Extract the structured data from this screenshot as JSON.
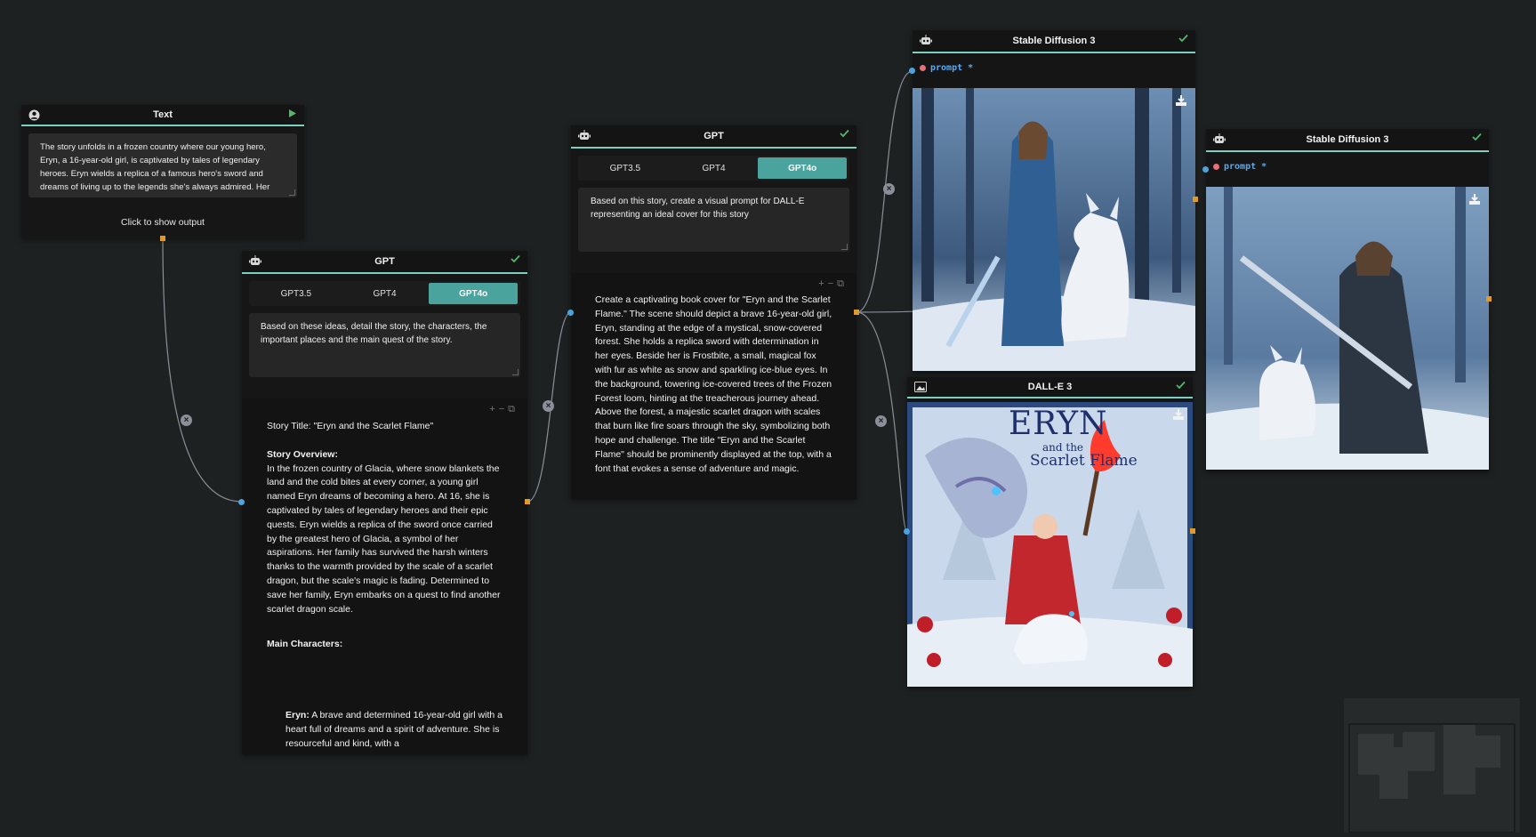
{
  "text_node": {
    "title": "Text",
    "content": "The story unfolds in a frozen country where our young hero, Eryn, a 16-year-old girl, is captivated by tales of legendary heroes. Eryn wields a replica of a famous hero's sword and dreams of living up to the legends she's always admired. Her",
    "show_output_label": "Click to show output"
  },
  "gpt_story_node": {
    "title": "GPT",
    "models": [
      "GPT3.5",
      "GPT4",
      "GPT4o"
    ],
    "selected_model": "GPT4o",
    "prompt": "Based on these ideas, detail the story, the characters, the important places and the main quest of the story.",
    "output": {
      "title_line": "Story Title: \"Eryn and the Scarlet Flame\"",
      "overview_heading": "Story Overview:",
      "overview_text": "In the frozen country of Glacia, where snow blankets the land and the cold bites at every corner, a young girl named Eryn dreams of becoming a hero. At 16, she is captivated by tales of legendary heroes and their epic quests. Eryn wields a replica of the sword once carried by the greatest hero of Glacia, a symbol of her aspirations. Her family has survived the harsh winters thanks to the warmth provided by the scale of a scarlet dragon, but the scale's magic is fading. Determined to save her family, Eryn embarks on a quest to find another scarlet dragon scale.",
      "characters_heading": "Main Characters:",
      "character_name": "Eryn:",
      "character_text": "A brave and determined 16-year-old girl with a heart full of dreams and a spirit of adventure. She is resourceful and kind, with a"
    }
  },
  "gpt_prompt_node": {
    "title": "GPT",
    "models": [
      "GPT3.5",
      "GPT4",
      "GPT4o"
    ],
    "selected_model": "GPT4o",
    "prompt": "Based on this story, create a visual prompt for DALL-E representing an ideal cover for this story",
    "output": "Create a captivating book cover for \"Eryn and the Scarlet Flame.\" The scene should depict a brave 16-year-old girl, Eryn, standing at the edge of a mystical, snow-covered forest. She holds a replica sword with determination in her eyes. Beside her is Frostbite, a small, magical fox with fur as white as snow and sparkling ice-blue eyes. In the background, towering ice-covered trees of the Frozen Forest loom, hinting at the treacherous journey ahead. Above the forest, a majestic scarlet dragon with scales that burn like fire soars through the sky, symbolizing both hope and challenge. The title \"Eryn and the Scarlet Flame\" should be prominently displayed at the top, with a font that evokes a sense of adventure and magic."
  },
  "sd3_node_1": {
    "title": "Stable Diffusion 3",
    "input_label": "prompt *"
  },
  "sd3_node_2": {
    "title": "Stable Diffusion 3",
    "input_label": "prompt *"
  },
  "dalle_node": {
    "title": "DALL-E 3",
    "cover_title": "ERYN",
    "cover_subtitle_1": "and the",
    "cover_subtitle_2": "Scarlet Flame"
  },
  "colors": {
    "background": "#1e2121",
    "accent": "#4aa39d",
    "header_line": "#7fcfc0",
    "input_handle": "#4da3e0",
    "output_handle": "#e09a2c",
    "prompt_label": "#5aa9f0",
    "required_dot": "#e4707a"
  },
  "icons": {
    "text_node": "user-icon",
    "run": "play-icon",
    "gpt_node": "robot-icon",
    "image_node": "image-icon",
    "done": "check-icon",
    "download": "download-icon",
    "remove_edge": "close-icon",
    "output_tools": [
      "plus-icon",
      "minus-icon",
      "copy-icon"
    ]
  }
}
